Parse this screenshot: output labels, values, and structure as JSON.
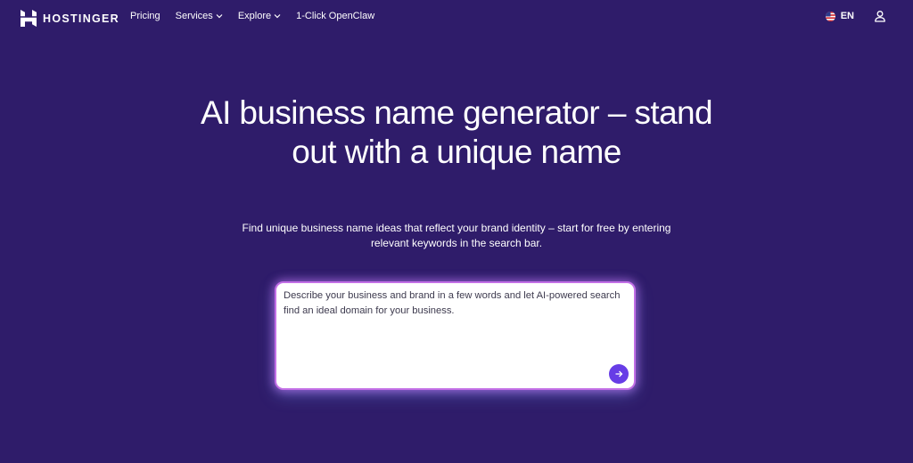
{
  "header": {
    "brand": "HOSTINGER",
    "nav": [
      {
        "label": "Pricing",
        "has_dropdown": false
      },
      {
        "label": "Services",
        "has_dropdown": true
      },
      {
        "label": "Explore",
        "has_dropdown": true
      },
      {
        "label": "1-Click OpenClaw",
        "has_dropdown": false
      }
    ],
    "language": "EN",
    "icons": {
      "logo": "hostinger-logo",
      "flag": "us-flag-icon",
      "account": "user-icon"
    }
  },
  "hero": {
    "title": "AI business name generator – stand out with a unique name",
    "subtitle": "Find unique business name ideas that reflect your brand identity – start for free by entering relevant keywords in the search bar."
  },
  "search": {
    "placeholder": "Describe your business and brand in a few words and let AI-powered search find an ideal domain for your business.",
    "value": "",
    "submit_icon": "arrow-right-icon"
  },
  "colors": {
    "background": "#2f1c6a",
    "accent": "#673de6",
    "glow": "#c26fe6"
  }
}
